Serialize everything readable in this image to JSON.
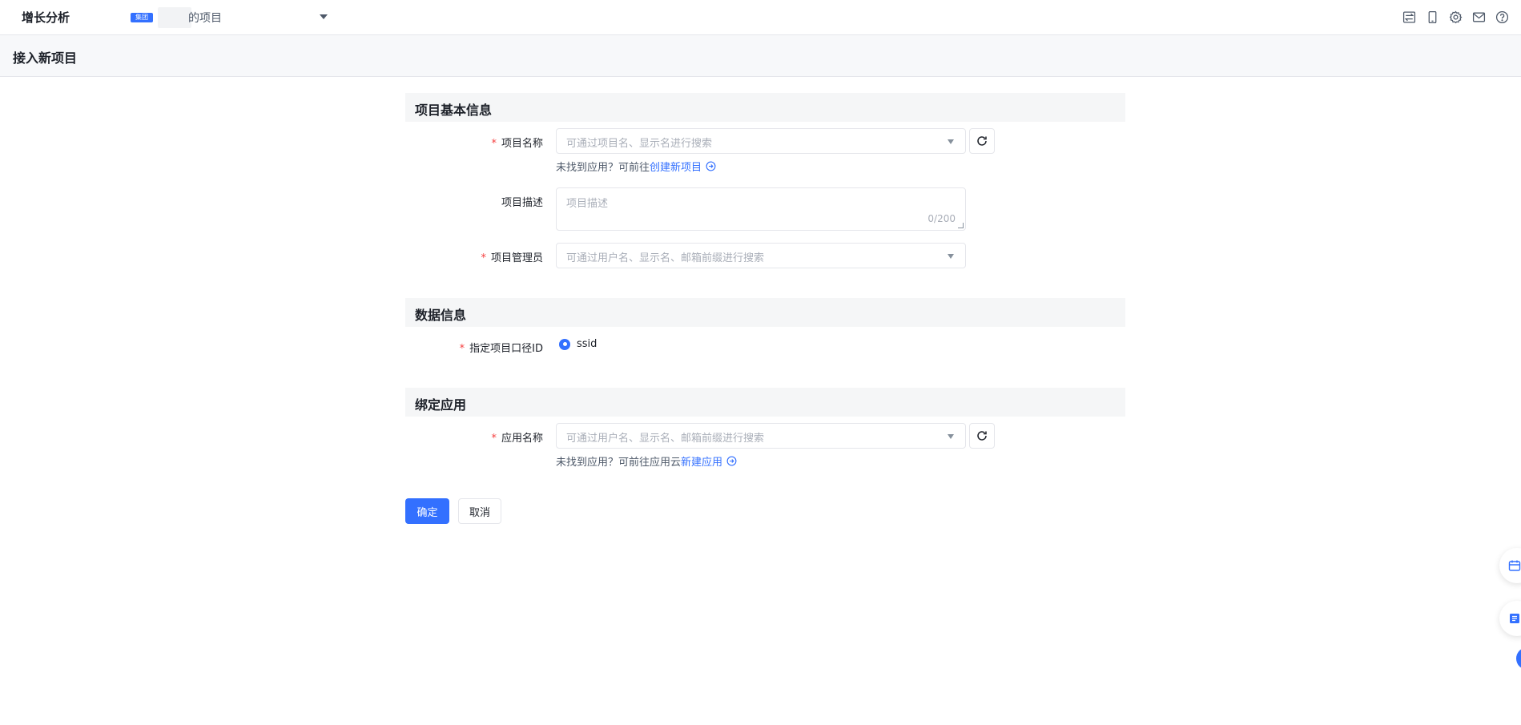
{
  "topbar": {
    "brand": "增长分析",
    "project_badge": "集团",
    "project_name": "的项目"
  },
  "page": {
    "title": "接入新项目"
  },
  "sections": {
    "basic": {
      "title": "项目基本信息"
    },
    "data": {
      "title": "数据信息"
    },
    "bind": {
      "title": "绑定应用"
    }
  },
  "form": {
    "project_name": {
      "label": "项目名称",
      "placeholder": "可通过项目名、显示名进行搜索",
      "hint_prefix": "未找到应用？可前往",
      "hint_link": "创建新项目"
    },
    "project_desc": {
      "label": "项目描述",
      "placeholder": "项目描述",
      "counter": "0/200"
    },
    "project_admin": {
      "label": "项目管理员",
      "placeholder": "可通过用户名、显示名、邮箱前缀进行搜索"
    },
    "id_scope": {
      "label": "指定项目口径ID",
      "option": "ssid"
    },
    "app_name": {
      "label": "应用名称",
      "placeholder": "可通过用户名、显示名、邮箱前缀进行搜索",
      "hint_prefix": "未找到应用？可前往应用云",
      "hint_link": "新建应用"
    },
    "required_mark": "*"
  },
  "actions": {
    "confirm": "确定",
    "cancel": "取消"
  },
  "colors": {
    "primary": "#3370ff",
    "required": "#f53f3f",
    "section_bg": "#f5f6f7"
  },
  "icons": [
    "switch-icon",
    "mobile-icon",
    "gear-icon",
    "mail-icon",
    "help-icon",
    "refresh-icon",
    "arrow-right-circle-icon",
    "calendar-icon",
    "document-icon"
  ]
}
